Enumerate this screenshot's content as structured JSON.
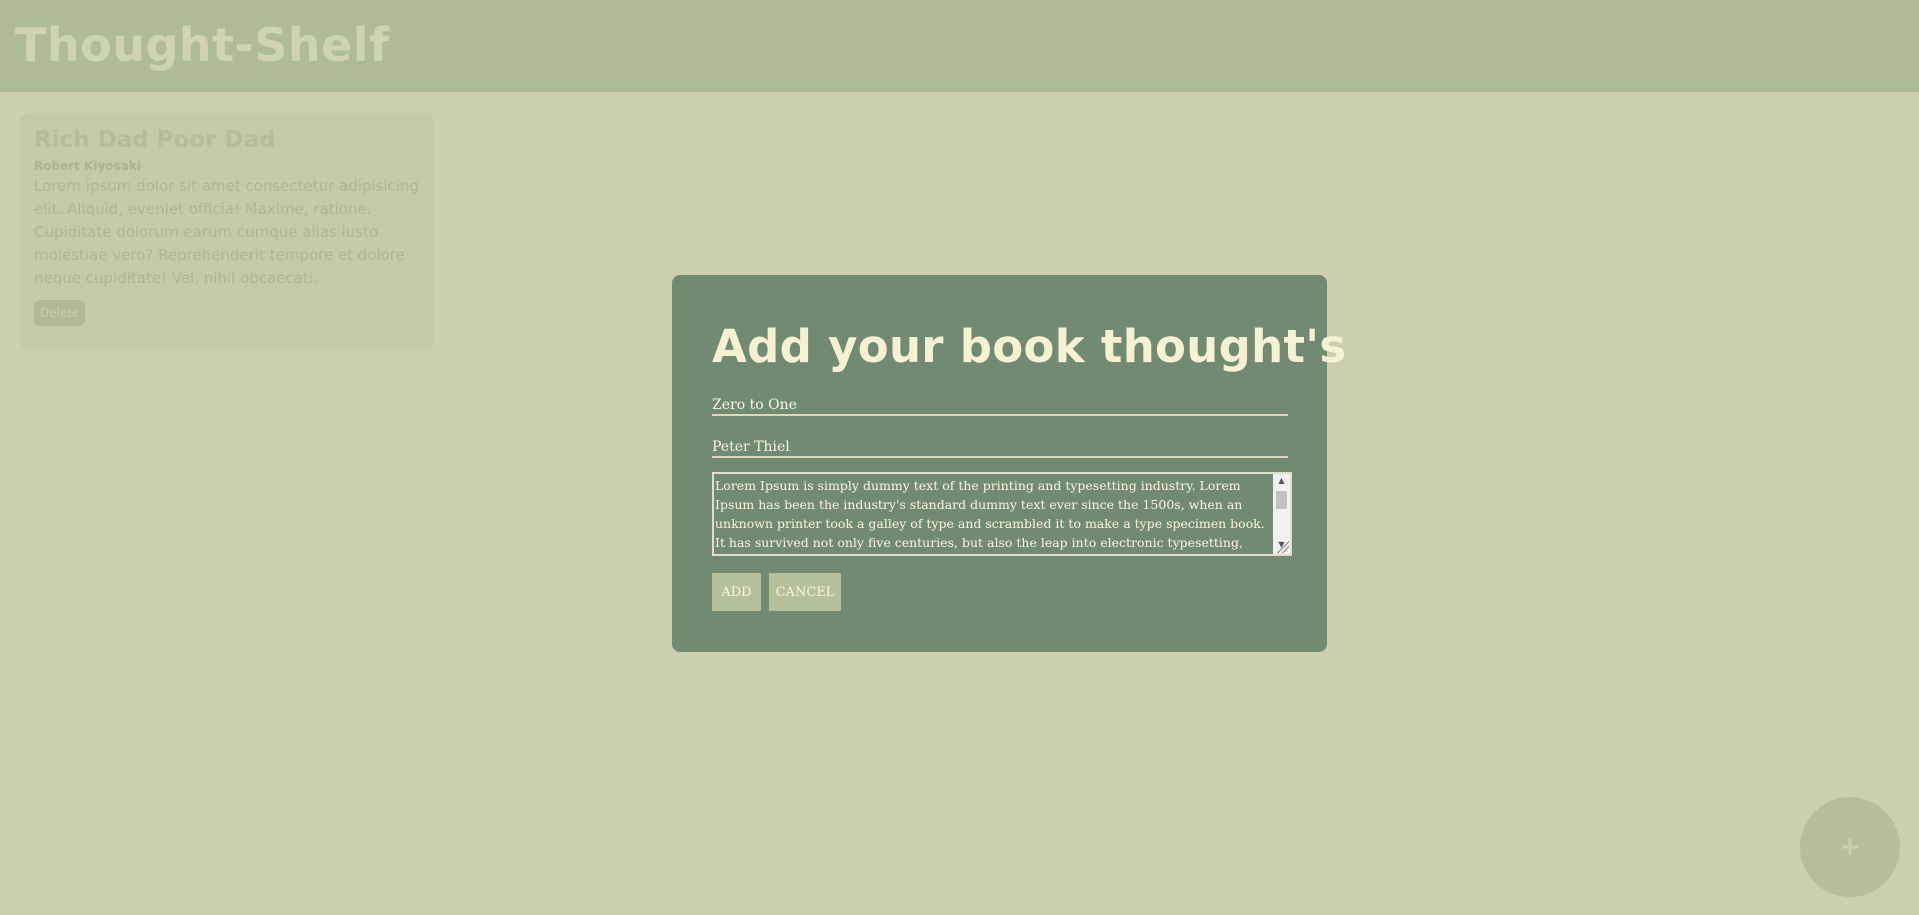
{
  "header": {
    "title": "Thought-Shelf"
  },
  "card": {
    "title": "Rich Dad Poor Dad",
    "author": "Robert Kiyosaki",
    "text": "Lorem ipsum dolor sit amet consectetur adipisicing elit. Aliquid, eveniet officia! Maxime, ratione. Cupiditate dolorum earum cumque alias iusto molestiae vero? Reprehenderit tempore et dolore neque cupiditate! Vel, nihil obcaecati.",
    "delete_label": "Delete"
  },
  "fab": {
    "label": "+"
  },
  "modal": {
    "title": "Add your book thought's",
    "title_field": "Zero to One",
    "author_field": "Peter Thiel",
    "thought_text": "Lorem Ipsum is simply dummy text of the printing and typesetting industry. Lorem Ipsum has been the industry's standard dummy text ever since the 1500s, when an unknown printer took a galley of type and scrambled it to make a type specimen book. It has survived not only five centuries, but also the leap into electronic typesetting, remaining",
    "add_label": "ADD",
    "cancel_label": "CANCEL",
    "scroll_up": "▲",
    "scroll_down": "▼"
  },
  "colors": {
    "background": "#cbcfae",
    "header": "#afba97",
    "modal": "#718a72",
    "modal_text": "#f7f1d4",
    "button": "#b5bf99"
  }
}
